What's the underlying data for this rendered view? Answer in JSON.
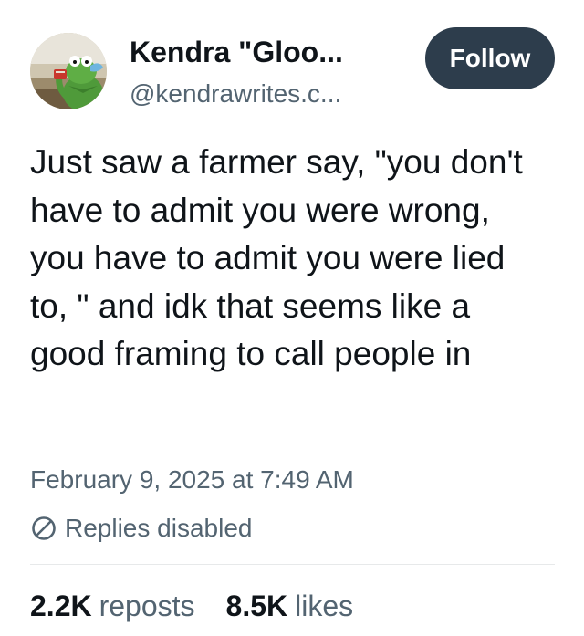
{
  "author": {
    "display_name": "Kendra \"Gloo...",
    "handle": "@kendrawrites.c...",
    "avatar_icon": "kermit-sipping-tea-avatar"
  },
  "follow_button": {
    "label": "Follow",
    "background": "#2d3d4c",
    "text_color": "#ffffff"
  },
  "post": {
    "text": "Just saw a farmer say, \"you don't have to admit you were wrong, you have to admit you were lied to, \" and idk that seems like a good framing to call people in",
    "timestamp": "February 9, 2025 at 7:49 AM",
    "replies_status": "Replies disabled",
    "replies_icon": "no-entry-icon"
  },
  "stats": {
    "reposts_count": "2.2K",
    "reposts_label": "reposts",
    "likes_count": "8.5K",
    "likes_label": "likes"
  },
  "colors": {
    "primary_text": "#0f1419",
    "secondary_text": "#536471",
    "divider": "#e7e9ea"
  }
}
